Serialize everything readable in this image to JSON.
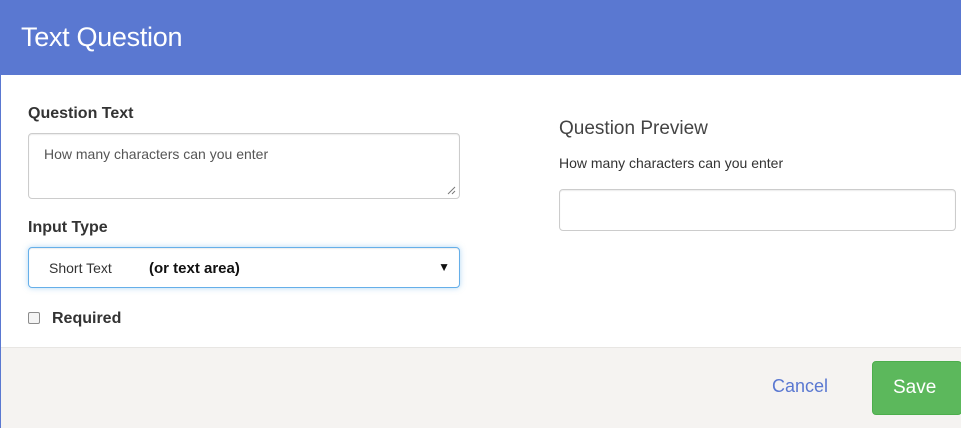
{
  "modal": {
    "title": "Text Question"
  },
  "form": {
    "question_text_label": "Question Text",
    "question_text_value": "How many characters can you enter",
    "input_type_label": "Input Type",
    "input_type_selected": "Short Text",
    "input_type_hint": "(or text area)",
    "required_label": "Required",
    "required_checked": false
  },
  "preview": {
    "title": "Question Preview",
    "question": "How many characters can you enter",
    "input_value": ""
  },
  "footer": {
    "cancel_label": "Cancel",
    "save_label": "Save"
  },
  "colors": {
    "header_bg": "#5a78d1",
    "save_bg": "#5cb85c",
    "link": "#5a78d1",
    "footer_bg": "#f5f3f1"
  },
  "icons": {
    "select_caret": "caret-down-icon",
    "textarea_resize": "resize-handle-icon"
  }
}
